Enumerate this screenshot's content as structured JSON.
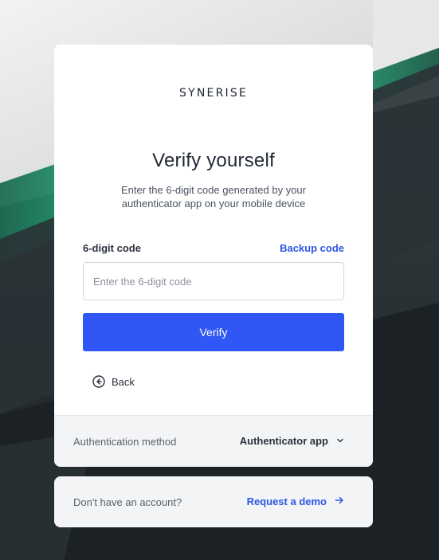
{
  "brand": {
    "logo_text": "SYNERISE"
  },
  "heading": {
    "title": "Verify yourself",
    "subtitle": "Enter the 6-digit code generated by your authenticator app on your mobile device"
  },
  "form": {
    "code_label": "6-digit code",
    "backup_link": "Backup code",
    "code_placeholder": "Enter the 6-digit code",
    "code_value": "",
    "verify_button": "Verify",
    "back_label": "Back"
  },
  "auth_method": {
    "label": "Authentication method",
    "selected": "Authenticator app"
  },
  "signup": {
    "text": "Don't have an account?",
    "link": "Request a demo"
  },
  "colors": {
    "primary": "#3056f5",
    "link": "#2d56e4",
    "accent_bg": "#2fe39a"
  },
  "icons": {
    "back": "arrow-left-circle-icon",
    "dropdown": "chevron-down-icon",
    "demo": "arrow-right-icon"
  }
}
